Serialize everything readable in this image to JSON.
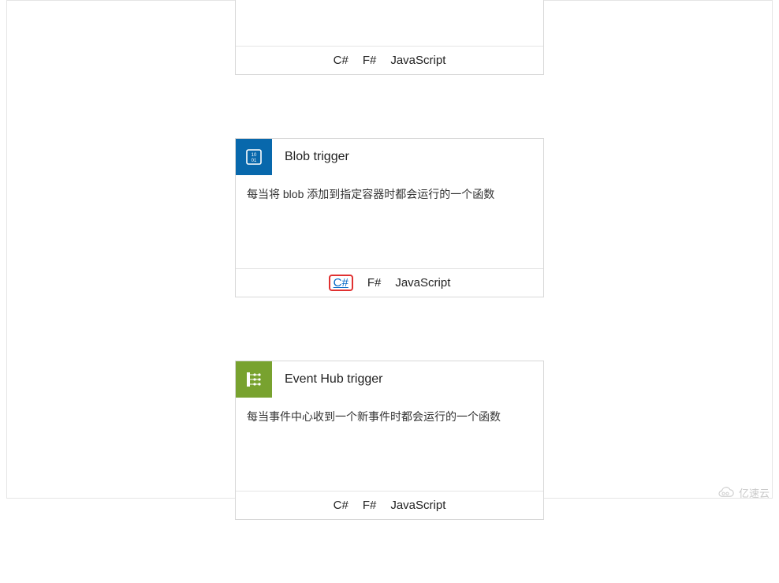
{
  "cards": [
    {
      "title": "",
      "description": "",
      "icon": "",
      "languages": [
        {
          "label": "C#",
          "highlighted": false
        },
        {
          "label": "F#",
          "highlighted": false
        },
        {
          "label": "JavaScript",
          "highlighted": false
        }
      ]
    },
    {
      "title": "Blob trigger",
      "description": "每当将 blob 添加到指定容器时都会运行的一个函数",
      "icon": "blob-icon",
      "icon_bg": "#0868ac",
      "languages": [
        {
          "label": "C#",
          "highlighted": true
        },
        {
          "label": "F#",
          "highlighted": false
        },
        {
          "label": "JavaScript",
          "highlighted": false
        }
      ]
    },
    {
      "title": "Event Hub trigger",
      "description": "每当事件中心收到一个新事件时都会运行的一个函数",
      "icon": "eventhub-icon",
      "icon_bg": "#78a22f",
      "languages": [
        {
          "label": "C#",
          "highlighted": false
        },
        {
          "label": "F#",
          "highlighted": false
        },
        {
          "label": "JavaScript",
          "highlighted": false
        }
      ]
    }
  ],
  "watermark": "亿速云"
}
